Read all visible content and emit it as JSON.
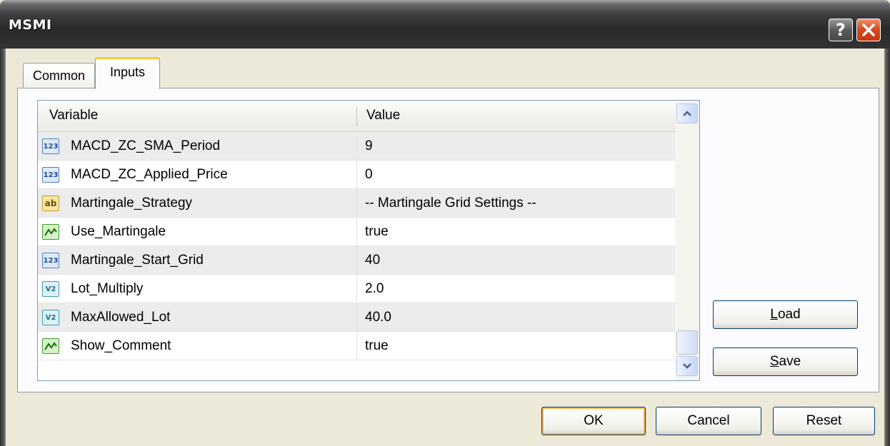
{
  "window": {
    "title": "MSMI"
  },
  "tabs": [
    {
      "label": "Common"
    },
    {
      "label": "Inputs"
    }
  ],
  "grid": {
    "headers": {
      "variable": "Variable",
      "value": "Value"
    },
    "rows": [
      {
        "icon": "integer-icon",
        "icon_text": "123",
        "variable": "MACD_ZC_SMA_Period",
        "value": "9"
      },
      {
        "icon": "integer-icon",
        "icon_text": "123",
        "variable": "MACD_ZC_Applied_Price",
        "value": "0"
      },
      {
        "icon": "string-icon",
        "icon_text": "ab",
        "variable": "Martingale_Strategy",
        "value": "-- Martingale Grid Settings --"
      },
      {
        "icon": "boolean-icon",
        "icon_text": "",
        "variable": "Use_Martingale",
        "value": "true"
      },
      {
        "icon": "integer-icon",
        "icon_text": "123",
        "variable": "Martingale_Start_Grid",
        "value": "40"
      },
      {
        "icon": "double-icon",
        "icon_text": "V2",
        "variable": "Lot_Multiply",
        "value": "2.0"
      },
      {
        "icon": "double-icon",
        "icon_text": "V2",
        "variable": "MaxAllowed_Lot",
        "value": "40.0"
      },
      {
        "icon": "boolean-icon",
        "icon_text": "",
        "variable": "Show_Comment",
        "value": "true"
      }
    ]
  },
  "buttons": {
    "load": {
      "key": "L",
      "rest": "oad"
    },
    "save": {
      "key": "S",
      "rest": "ave"
    },
    "ok": "OK",
    "cancel": "Cancel",
    "reset": "Reset"
  },
  "title_buttons": {
    "help": "?"
  }
}
